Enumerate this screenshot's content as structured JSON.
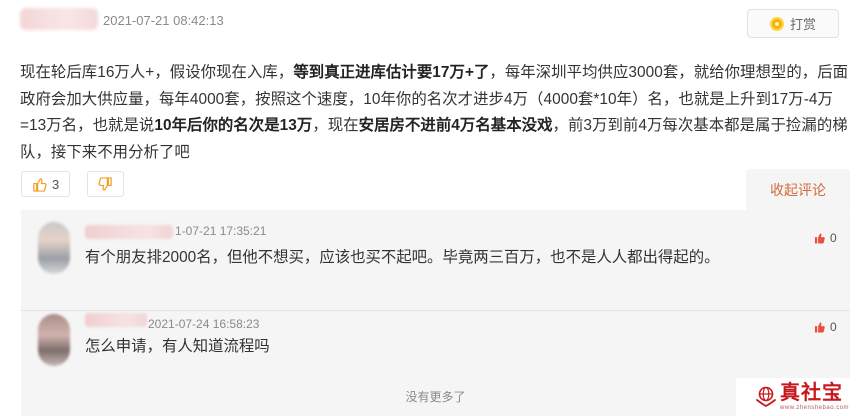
{
  "post": {
    "time": "2021-07-21 08:42:13",
    "reward_label": "打赏",
    "body": {
      "p1": "现在轮后库16万人+，假设你现在入库，",
      "b1": "等到真正进库估计要17万+了",
      "p2": "，每年深圳平均供应3000套，就给你理想型的，后面政府会加大供应量，每年4000套，按照这个速度，10年你的名次才进步4万（4000套*10年）名，也就是上升到17万-4万=13万名，也就是说",
      "b2": "10年后你的名次是13万",
      "p3": "，现在",
      "b3": "安居房不进前4万名基本没戏",
      "p4": "，前3万到前4万每次基本都是属于捡漏的梯队，接下来不用分析了吧"
    },
    "like_count": "3",
    "collapse_label": "收起评论"
  },
  "comments": [
    {
      "time": "1-07-21 17:35:21",
      "text": "有个朋友排2000名，但他不想买，应该也买不起吧。毕竟两三百万，也不是人人都出得起的。",
      "likes": "0"
    },
    {
      "time": "2021-07-24 16:58:23",
      "text": "怎么申请，有人知道流程吗",
      "likes": "0"
    }
  ],
  "no_more_label": "没有更多了",
  "watermark": {
    "main": "真社宝",
    "sub": "www.zhenshebao.com"
  },
  "colors": {
    "accent": "#d16a3c",
    "like_red": "#e5533c",
    "panel": "#f5f5f5",
    "thumb_orange": "#f0a020"
  }
}
